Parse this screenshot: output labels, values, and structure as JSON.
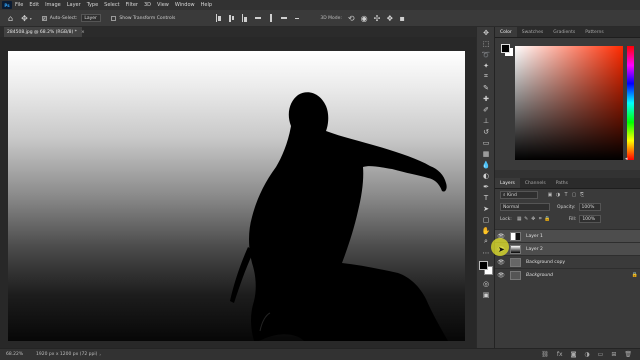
{
  "app": {
    "logo": "Ps"
  },
  "menu": [
    "File",
    "Edit",
    "Image",
    "Layer",
    "Type",
    "Select",
    "Filter",
    "3D",
    "View",
    "Window",
    "Help"
  ],
  "options": {
    "auto_select_label": "Auto-Select:",
    "auto_select_checked": true,
    "auto_select_target": "Layer",
    "show_transform_label": "Show Transform Controls",
    "show_transform_checked": false,
    "mode_3d_label": "3D Mode:"
  },
  "document": {
    "tab_title": "284508.jpg @ 68.2% (RGB/8) *",
    "close_glyph": "×"
  },
  "color_panel": {
    "tabs": [
      "Color",
      "Swatches",
      "Gradients",
      "Patterns"
    ],
    "active_tab": "Color",
    "hue": "#ff2a00"
  },
  "layers_panel": {
    "tabs": [
      "Layers",
      "Channels",
      "Paths"
    ],
    "active_tab": "Layers",
    "kind_filter": "Kind",
    "blend_mode": "Normal",
    "opacity_label": "Opacity:",
    "opacity_value": "100%",
    "lock_label": "Lock:",
    "fill_label": "Fill:",
    "fill_value": "100%",
    "layers": [
      {
        "name": "Layer 1",
        "visible": true,
        "selected": true,
        "italic": false,
        "locked": false
      },
      {
        "name": "Layer 2",
        "visible": true,
        "selected": true,
        "italic": false,
        "locked": false
      },
      {
        "name": "Background copy",
        "visible": true,
        "selected": false,
        "italic": false,
        "locked": false
      },
      {
        "name": "Background",
        "visible": true,
        "selected": false,
        "italic": true,
        "locked": true
      }
    ]
  },
  "status": {
    "zoom": "68.22%",
    "doc_info": "1920 px x 1200 px (72 ppi)"
  }
}
